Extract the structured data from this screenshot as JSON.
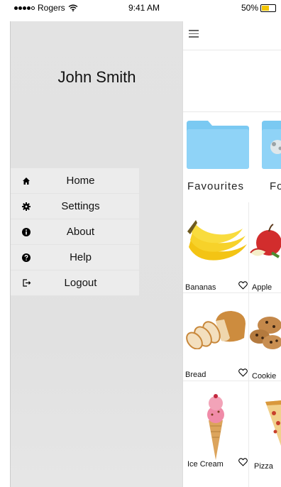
{
  "status_bar": {
    "carrier": "Rogers",
    "time": "9:41 AM",
    "battery": "50%",
    "battery_level": 0.5
  },
  "drawer": {
    "user_name": "John Smith",
    "menu": [
      {
        "label": "Home",
        "icon": "home-icon"
      },
      {
        "label": "Settings",
        "icon": "gear-icon"
      },
      {
        "label": "About",
        "icon": "info-icon"
      },
      {
        "label": "Help",
        "icon": "help-icon"
      },
      {
        "label": "Logout",
        "icon": "logout-icon"
      }
    ]
  },
  "content": {
    "folders": [
      {
        "label": "Favourites"
      },
      {
        "label": "Fo"
      }
    ],
    "foods": [
      {
        "label": "Bananas"
      },
      {
        "label": "Apple"
      },
      {
        "label": "Bread"
      },
      {
        "label": "Cookie"
      },
      {
        "label": "Ice Cream"
      },
      {
        "label": "Pizza"
      }
    ]
  },
  "colors": {
    "folder_blue": "#8fd3f7",
    "folder_tab": "#7ac9f2",
    "drawer_bg": "#e3e3e3",
    "battery_yellow": "#f2c500"
  }
}
